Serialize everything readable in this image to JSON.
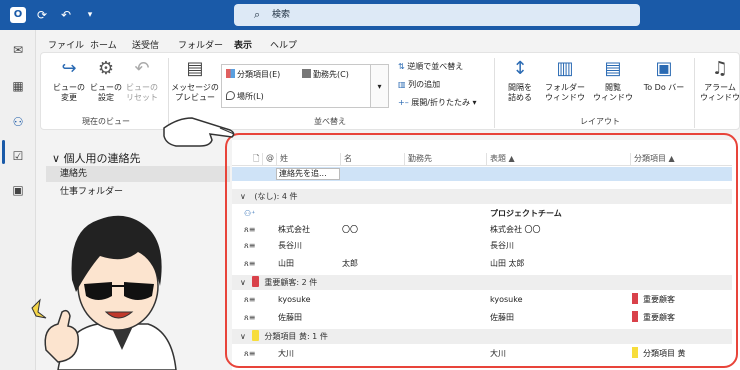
{
  "titlebar": {
    "search_placeholder": "検索",
    "icons": [
      "outlook-icon",
      "sync-icon",
      "undo-icon",
      "quick-access-dropdown-icon"
    ]
  },
  "menus": [
    "ファイル",
    "ホーム",
    "送受信",
    "フォルダー",
    "表示",
    "ヘルプ"
  ],
  "active_menu": "表示",
  "ribbon": {
    "current_view": {
      "label": "現在のビュー",
      "change_view": "ビューの\n変更",
      "view_settings": "ビューの\n設定",
      "reset_view": "ビューの\nリセット"
    },
    "arrangement": {
      "label": "並べ替え",
      "message_preview": "メッセージの\nプレビュー",
      "options": [
        "分類項目(E)",
        "勤務先(C)",
        "場所(L)"
      ],
      "reverse_sort": "逆順で並べ替え",
      "add_columns": "列の追加",
      "expand_collapse": "展開/折りたたみ"
    },
    "layout": {
      "label": "レイアウト",
      "column_spacing": "間隔を\n詰める",
      "folder_pane": "フォルダー\nウィンドウ",
      "reading_pane": "閲覧\nウィンドウ",
      "todo_bar": "To Do バー"
    },
    "window": {
      "reminders": "アラーム\nウィンドウ"
    }
  },
  "nav": {
    "header": "個人用の連絡先",
    "items": [
      "連絡先",
      "仕事フォルダー"
    ],
    "selected": "連絡先"
  },
  "list": {
    "columns": [
      "姓",
      "名",
      "勤務先",
      "表題",
      "分類項目"
    ],
    "new_contact_placeholder": "連絡先を追...",
    "groups": [
      {
        "label": "(なし): 4 件",
        "color": ""
      },
      {
        "label": "重要顧客: 2 件",
        "color": "#d9414a"
      },
      {
        "label": "分類項目 黄: 1 件",
        "color": "#f7dd3b"
      }
    ],
    "rows_none": [
      {
        "last": "",
        "first": "",
        "company": "",
        "title": "プロジェクトチーム",
        "group": true
      },
      {
        "last": "株式会社",
        "first": "〇〇",
        "company": "",
        "title": "株式会社 〇〇"
      },
      {
        "last": "長谷川",
        "first": "",
        "company": "",
        "title": "長谷川"
      },
      {
        "last": "山田",
        "first": "太郎",
        "company": "",
        "title": "山田 太郎"
      }
    ],
    "rows_important": [
      {
        "last": "kyosuke",
        "first": "",
        "company": "",
        "title": "kyosuke",
        "category": "重要顧客"
      },
      {
        "last": "佐藤田",
        "first": "",
        "company": "",
        "title": "佐藤田",
        "category": "重要顧客"
      }
    ],
    "rows_yellow": [
      {
        "last": "大川",
        "first": "",
        "company": "",
        "title": "大川",
        "category": "分類項目 黄"
      }
    ]
  },
  "colors": {
    "accent": "#1a5aa8",
    "highlight": "#e8443a",
    "important": "#d9414a",
    "yellow": "#f7dd3b"
  }
}
